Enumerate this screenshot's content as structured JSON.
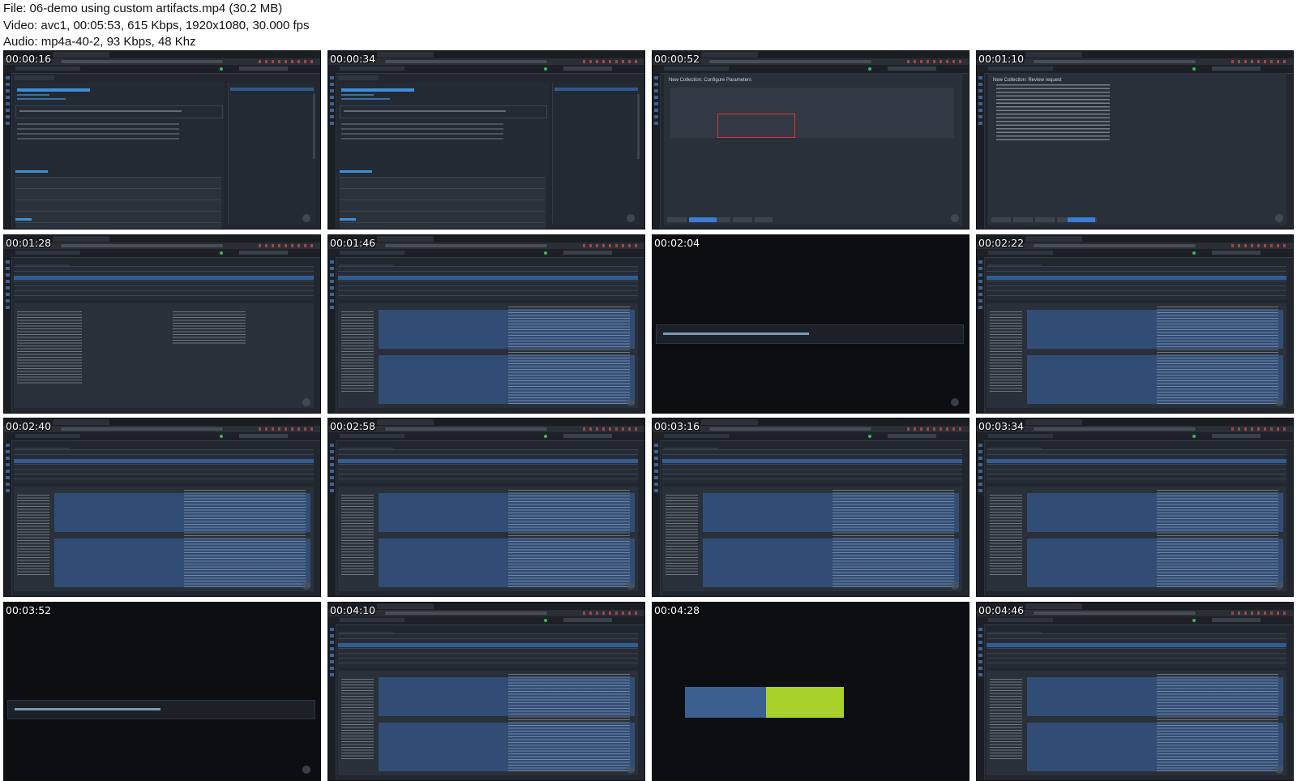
{
  "header": {
    "file_line": "File: 06-demo using custom artifacts.mp4 (30.2 MB)",
    "video_line": "Video: avc1, 00:05:53, 615 Kbps, 1920x1080, 30.000 fps",
    "audio_line": "Audio: mp4a-40-2, 93 Kbps, 48 Khz"
  },
  "frames": [
    {
      "timestamp": "00:00:16",
      "view": "artifact-details"
    },
    {
      "timestamp": "00:00:34",
      "view": "artifact-details"
    },
    {
      "timestamp": "00:00:52",
      "view": "configure-parameters",
      "title": "New Collection: Configure Parameters"
    },
    {
      "timestamp": "00:01:10",
      "view": "review-request",
      "title": "New Collection: Review request"
    },
    {
      "timestamp": "00:01:28",
      "view": "flows-overview"
    },
    {
      "timestamp": "00:01:46",
      "view": "flows-results"
    },
    {
      "timestamp": "00:02:04",
      "view": "notebook-query"
    },
    {
      "timestamp": "00:02:22",
      "view": "flows-results"
    },
    {
      "timestamp": "00:02:40",
      "view": "flows-results"
    },
    {
      "timestamp": "00:02:58",
      "view": "flows-results"
    },
    {
      "timestamp": "00:03:16",
      "view": "flows-results"
    },
    {
      "timestamp": "00:03:34",
      "view": "flows-results"
    },
    {
      "timestamp": "00:03:52",
      "view": "notebook-query"
    },
    {
      "timestamp": "00:04:10",
      "view": "flows-results"
    },
    {
      "timestamp": "00:04:28",
      "view": "highlight-cell"
    },
    {
      "timestamp": "00:04:46",
      "view": "flows-results"
    }
  ]
}
